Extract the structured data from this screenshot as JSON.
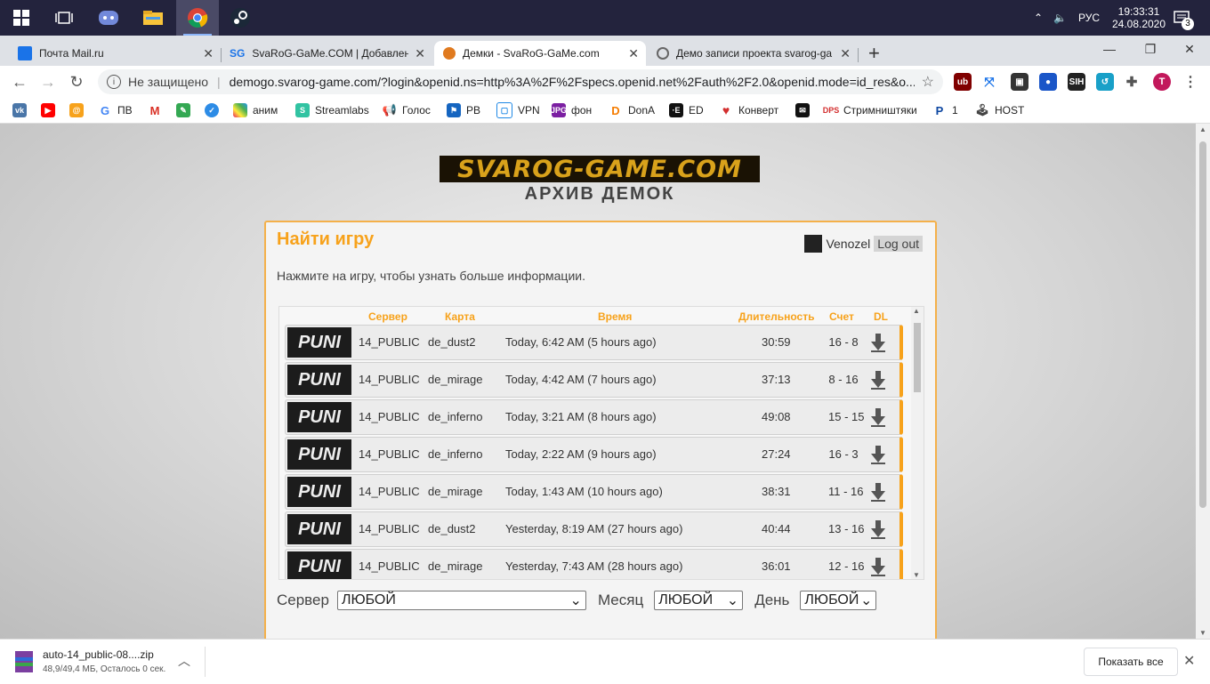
{
  "taskbar": {
    "clock_time": "19:33:31",
    "clock_date": "24.08.2020",
    "lang": "РУС",
    "notif_count": "3"
  },
  "tabs": [
    {
      "title": "Почта Mail.ru"
    },
    {
      "title": "SvaRoG-GaMe.COM | Добавлени"
    },
    {
      "title": "Демки - SvaRoG-GaMe.com"
    },
    {
      "title": "Демо записи проекта svarog-ga"
    }
  ],
  "address": {
    "security": "Не защищено",
    "url": "demogo.svarog-game.com/?login&openid.ns=http%3A%2F%2Fspecs.openid.net%2Fauth%2F2.0&openid.mode=id_res&o..."
  },
  "bookmarks": [
    "ПВ",
    "аним",
    "Streamlabs",
    "Голос",
    "PB",
    "VPN",
    "фон",
    "DonA",
    "ED",
    "Конверт",
    "Стримништяки",
    "1",
    "HOST"
  ],
  "page": {
    "logo": "SVAROG-GAME.COM",
    "subtitle": "АРХИВ ДЕМОК",
    "heading": "Найти игру",
    "hint": "Нажмите на игру, чтобы узнать больше информации.",
    "username": "Venozel",
    "logout": "Log out",
    "columns": {
      "server": "Сервер",
      "map": "Карта",
      "time": "Время",
      "duration": "Длительность",
      "score": "Счет",
      "dl": "DL"
    },
    "rows": [
      {
        "server": "14_PUBLIC",
        "map": "de_dust2",
        "time": "Today, 6:42 AM (5 hours ago)",
        "duration": "30:59",
        "score": "16 - 8"
      },
      {
        "server": "14_PUBLIC",
        "map": "de_mirage",
        "time": "Today, 4:42 AM (7 hours ago)",
        "duration": "37:13",
        "score": "8 - 16"
      },
      {
        "server": "14_PUBLIC",
        "map": "de_inferno",
        "time": "Today, 3:21 AM (8 hours ago)",
        "duration": "49:08",
        "score": "15 - 15"
      },
      {
        "server": "14_PUBLIC",
        "map": "de_inferno",
        "time": "Today, 2:22 AM (9 hours ago)",
        "duration": "27:24",
        "score": "16 - 3"
      },
      {
        "server": "14_PUBLIC",
        "map": "de_mirage",
        "time": "Today, 1:43 AM (10 hours ago)",
        "duration": "38:31",
        "score": "11 - 16"
      },
      {
        "server": "14_PUBLIC",
        "map": "de_dust2",
        "time": "Yesterday, 8:19 AM (27 hours ago)",
        "duration": "40:44",
        "score": "13 - 16"
      },
      {
        "server": "14_PUBLIC",
        "map": "de_mirage",
        "time": "Yesterday, 7:43 AM (28 hours ago)",
        "duration": "36:01",
        "score": "12 - 16"
      }
    ],
    "filters": {
      "server_label": "Сервер",
      "server_value": "ЛЮБОЙ",
      "month_label": "Месяц",
      "month_value": "ЛЮБОЙ",
      "day_label": "День",
      "day_value": "ЛЮБОЙ"
    }
  },
  "download": {
    "filename": "auto-14_public-08....zip",
    "status": "48,9/49,4 МБ, Осталось 0 сек.",
    "show_all": "Показать все"
  }
}
